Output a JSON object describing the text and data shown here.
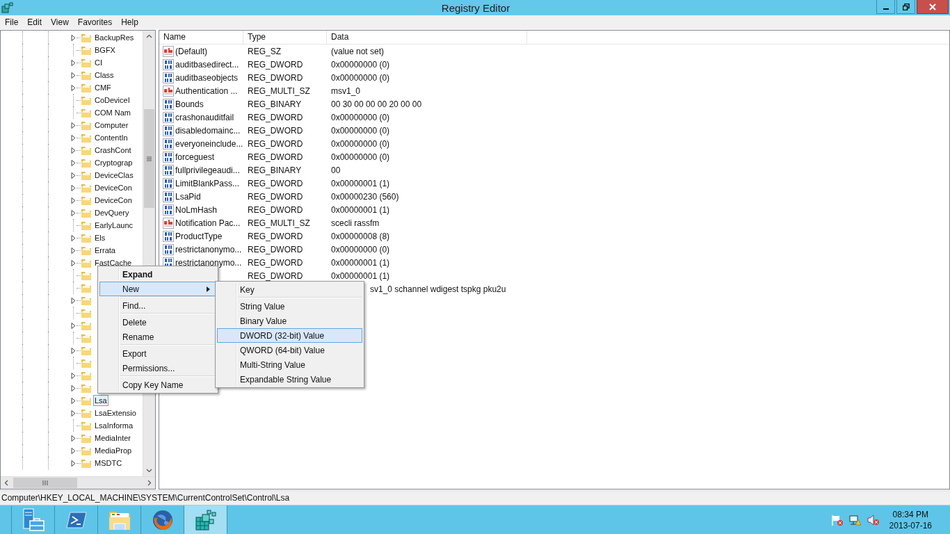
{
  "window": {
    "title": "Registry Editor"
  },
  "menu_bar": [
    "File",
    "Edit",
    "View",
    "Favorites",
    "Help"
  ],
  "tree": {
    "items": [
      {
        "label": "BackupRes",
        "expandable": true,
        "selected": false
      },
      {
        "label": "BGFX",
        "expandable": false,
        "selected": false
      },
      {
        "label": "CI",
        "expandable": true,
        "selected": false
      },
      {
        "label": "Class",
        "expandable": true,
        "selected": false
      },
      {
        "label": "CMF",
        "expandable": true,
        "selected": false
      },
      {
        "label": "CoDeviceI",
        "expandable": false,
        "selected": false
      },
      {
        "label": "COM Nam",
        "expandable": false,
        "selected": false
      },
      {
        "label": "Computer",
        "expandable": true,
        "selected": false
      },
      {
        "label": "ContentIn",
        "expandable": true,
        "selected": false
      },
      {
        "label": "CrashCont",
        "expandable": true,
        "selected": false
      },
      {
        "label": "Cryptograp",
        "expandable": true,
        "selected": false
      },
      {
        "label": "DeviceClas",
        "expandable": true,
        "selected": false
      },
      {
        "label": "DeviceCon",
        "expandable": true,
        "selected": false
      },
      {
        "label": "DeviceCon",
        "expandable": true,
        "selected": false
      },
      {
        "label": "DevQuery",
        "expandable": true,
        "selected": false
      },
      {
        "label": "EarlyLaunc",
        "expandable": false,
        "selected": false
      },
      {
        "label": "Els",
        "expandable": true,
        "selected": false
      },
      {
        "label": "Errata",
        "expandable": true,
        "selected": false
      },
      {
        "label": "FastCache",
        "expandable": true,
        "selected": false
      },
      {
        "expandable": false
      },
      {
        "expandable": false
      },
      {
        "expandable": true
      },
      {
        "expandable": false
      },
      {
        "expandable": true
      },
      {
        "expandable": false
      },
      {
        "expandable": true
      },
      {
        "expandable": false
      },
      {
        "expandable": true
      },
      {
        "expandable": true
      },
      {
        "label": "Lsa",
        "expandable": true,
        "selected": true
      },
      {
        "label": "LsaExtensio",
        "expandable": true,
        "selected": false
      },
      {
        "label": "LsaInforma",
        "expandable": false,
        "selected": false
      },
      {
        "label": "MediaInter",
        "expandable": true,
        "selected": false
      },
      {
        "label": "MediaProp",
        "expandable": true,
        "selected": false
      },
      {
        "label": "MSDTC",
        "expandable": true,
        "selected": false
      }
    ]
  },
  "list": {
    "columns": [
      "Name",
      "Type",
      "Data"
    ],
    "rows": [
      {
        "kind": "string",
        "name": "(Default)",
        "type": "REG_SZ",
        "data": "(value not set)"
      },
      {
        "kind": "binary",
        "name": "auditbasedirect...",
        "type": "REG_DWORD",
        "data": "0x00000000 (0)"
      },
      {
        "kind": "binary",
        "name": "auditbaseobjects",
        "type": "REG_DWORD",
        "data": "0x00000000 (0)"
      },
      {
        "kind": "string",
        "name": "Authentication ...",
        "type": "REG_MULTI_SZ",
        "data": "msv1_0"
      },
      {
        "kind": "binary",
        "name": "Bounds",
        "type": "REG_BINARY",
        "data": "00 30 00 00 00 20 00 00"
      },
      {
        "kind": "binary",
        "name": "crashonauditfail",
        "type": "REG_DWORD",
        "data": "0x00000000 (0)"
      },
      {
        "kind": "binary",
        "name": "disabledomainc...",
        "type": "REG_DWORD",
        "data": "0x00000000 (0)"
      },
      {
        "kind": "binary",
        "name": "everyoneinclude...",
        "type": "REG_DWORD",
        "data": "0x00000000 (0)"
      },
      {
        "kind": "binary",
        "name": "forceguest",
        "type": "REG_DWORD",
        "data": "0x00000000 (0)"
      },
      {
        "kind": "binary",
        "name": "fullprivilegeaudi...",
        "type": "REG_BINARY",
        "data": "00"
      },
      {
        "kind": "binary",
        "name": "LimitBlankPass...",
        "type": "REG_DWORD",
        "data": "0x00000001 (1)"
      },
      {
        "kind": "binary",
        "name": "LsaPid",
        "type": "REG_DWORD",
        "data": "0x00000230 (560)"
      },
      {
        "kind": "binary",
        "name": "NoLmHash",
        "type": "REG_DWORD",
        "data": "0x00000001 (1)"
      },
      {
        "kind": "string",
        "name": "Notification Pac...",
        "type": "REG_MULTI_SZ",
        "data": "scecli rassfm"
      },
      {
        "kind": "binary",
        "name": "ProductType",
        "type": "REG_DWORD",
        "data": "0x00000008 (8)"
      },
      {
        "kind": "binary",
        "name": "restrictanonymo...",
        "type": "REG_DWORD",
        "data": "0x00000000 (0)"
      },
      {
        "kind": "binary",
        "name": "restrictanonymo...",
        "type": "REG_DWORD",
        "data": "0x00000001 (1)"
      },
      {
        "kind": "covered",
        "type": "REG_DWORD",
        "data": "0x00000001 (1)"
      },
      {
        "kind": "shifted",
        "data": "sv1_0 schannel wdigest tspkg pku2u"
      }
    ]
  },
  "context_menu": {
    "items": [
      {
        "kind": "item",
        "label": "Expand",
        "default": true,
        "selected": false,
        "submenu": false
      },
      {
        "kind": "item",
        "label": "New",
        "default": false,
        "selected": true,
        "submenu": true
      },
      {
        "kind": "separator"
      },
      {
        "kind": "item",
        "label": "Find...",
        "default": false,
        "selected": false,
        "submenu": false
      },
      {
        "kind": "separator"
      },
      {
        "kind": "item",
        "label": "Delete",
        "default": false,
        "selected": false,
        "submenu": false
      },
      {
        "kind": "item",
        "label": "Rename",
        "default": false,
        "selected": false,
        "submenu": false
      },
      {
        "kind": "separator"
      },
      {
        "kind": "item",
        "label": "Export",
        "default": false,
        "selected": false,
        "submenu": false
      },
      {
        "kind": "item",
        "label": "Permissions...",
        "default": false,
        "selected": false,
        "submenu": false
      },
      {
        "kind": "separator"
      },
      {
        "kind": "item",
        "label": "Copy Key Name",
        "default": false,
        "selected": false,
        "submenu": false
      }
    ]
  },
  "submenu": {
    "items": [
      {
        "kind": "item",
        "label": "Key",
        "selected": false
      },
      {
        "kind": "separator"
      },
      {
        "kind": "item",
        "label": "String Value",
        "selected": false
      },
      {
        "kind": "item",
        "label": "Binary Value",
        "selected": false
      },
      {
        "kind": "item",
        "label": "DWORD (32-bit) Value",
        "selected": true
      },
      {
        "kind": "item",
        "label": "QWORD (64-bit) Value",
        "selected": false
      },
      {
        "kind": "item",
        "label": "Multi-String Value",
        "selected": false
      },
      {
        "kind": "item",
        "label": "Expandable String Value",
        "selected": false
      }
    ]
  },
  "status_bar": {
    "path": "Computer\\HKEY_LOCAL_MACHINE\\SYSTEM\\CurrentControlSet\\Control\\Lsa"
  },
  "taskbar": {
    "apps": [
      {
        "kind": "server",
        "selected": false
      },
      {
        "kind": "shell",
        "selected": false
      },
      {
        "kind": "folder",
        "selected": false
      },
      {
        "kind": "globe",
        "selected": false
      },
      {
        "kind": "cubes",
        "selected": true
      }
    ],
    "clock": {
      "time": "08:34 PM",
      "date": "2013-07-16"
    }
  }
}
